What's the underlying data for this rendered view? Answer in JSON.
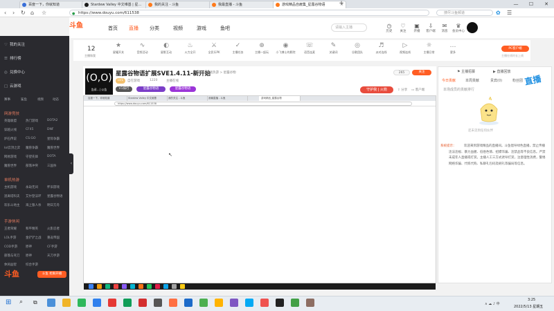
{
  "browser": {
    "tabs": [
      {
        "label": "百度一下，你就知道",
        "active": false
      },
      {
        "label": "Stardew Valley 中文维基 | 星…",
        "active": false
      },
      {
        "label": "我的关注 - 斗鱼",
        "active": false
      },
      {
        "label": "我最直播 - 斗鱼",
        "active": false
      },
      {
        "label": "游戏精品自雇集_星露谷物语",
        "active": true
      }
    ],
    "new_tab": "+",
    "address": "https://www.douyu.com/611538",
    "search_placeholder": "搜尽斗鱼频道"
  },
  "header": {
    "logo": "斗鱼",
    "nav": [
      "首页",
      "直播",
      "分类",
      "视频",
      "游戏",
      "鱼吧"
    ],
    "active_nav": "直播",
    "search_placeholder": "请输入主播",
    "icons": [
      "历史",
      "关注",
      "开播",
      "客户端",
      "消息",
      "会员中心"
    ]
  },
  "categories": {
    "count": "12",
    "count_label": "主播和我",
    "items": [
      "星耀开关",
      "音频活动",
      "星影互动",
      "火力全开",
      "全民乐PK",
      "主播任务",
      "主播一起玩",
      "小飞博士的影院",
      "语音连麦",
      "关键词",
      "谷歌团队",
      "派对连线",
      "视频连线",
      "主播日常",
      "更多"
    ],
    "pc_client": "PC客户端",
    "pc_sub": "主播在线时长上线"
  },
  "sidebar": {
    "items": [
      {
        "icon": "♡",
        "label": "我的关注"
      },
      {
        "icon": "☰",
        "label": "排行榜"
      },
      {
        "icon": "◎",
        "label": "兑换中心"
      },
      {
        "icon": "□",
        "label": "云游戏"
      }
    ],
    "events_row": [
      "赛事",
      "鲨鱼",
      "视频",
      "动态"
    ],
    "sections": [
      {
        "title": "网游竞技",
        "more": "全部 >",
        "games": [
          "英雄联盟",
          "热门游戏",
          "DOTA2",
          "穿越火线",
          "CF45",
          "DNF",
          "炉石传说",
          "CS:GO",
          "星际争霸",
          "lol云顶之弈",
          "魔兽争霸",
          "魔兽世界",
          "网易游戏",
          "守望先锋",
          "DOTA",
          "魔兽世界",
          "部落冲突",
          "三国杀"
        ]
      },
      {
        "title": "单机热游",
        "more": "全部 >",
        "games": [
          "主机游戏",
          "永劫无间",
          "怀旧游戏",
          "逃离塔科夫",
          "艾尔登法环",
          "星露谷物语",
          "欢乐斗地主",
          "海上狼人杀",
          "明日方舟"
        ]
      },
      {
        "title": "手游休闲",
        "more": "全部 >",
        "games": [
          "王者荣耀",
          "和平精英",
          "火影忍者",
          "LOL手游",
          "金铲铲之战",
          "重返帝国",
          "COD手游",
          "原神",
          "CF手游",
          "部落与弯刀",
          "原神",
          "天刀手游",
          "休闲益智",
          "综合手游"
        ]
      }
    ],
    "promo": "斗鱼 抢鲜开播"
  },
  "room": {
    "avatar_text": "告诉…| 公告",
    "title": "星露谷物语扩展SVE1.4.11-新开始",
    "report": "举报",
    "breadcrumb": "游戏热游 > 星露谷物",
    "tags": [
      "LV1",
      "自在游戏",
      "1220",
      "主播在线"
    ],
    "badges": [
      "V1排行",
      "星露谷物语",
      "星露谷物语"
    ],
    "follow_count": "265",
    "follow_label": "关注",
    "gift_label": "守护我 | 火箭",
    "actions": [
      "分享",
      "客户端"
    ]
  },
  "video": {
    "inner_tabs": [
      "百度一下，你就知道",
      "Stardew Valley 中文维基",
      "我的关注 - 斗鱼",
      "我最直播 - 斗鱼",
      "游戏精品_星露谷物"
    ],
    "inner_url": "https://www.douyu.com/611538"
  },
  "right_panel": {
    "top_links": [
      "主播招募",
      "直播回放"
    ],
    "tabs": [
      "今日贡献",
      "本周贡献",
      "贵宾(0)",
      "粉丝团"
    ],
    "note": "本场成员的贡献排行",
    "mascot_caption": "还未见到任何伙伴",
    "badge": "直播",
    "sys_label": "系统提示：",
    "sys_msg": "欢迎来到游戏精品的直播间。斗鱼倡导绿色直播，禁止传播违法违规、暴力血腥、低俗色情、招嫖诈骗、违禁品等不良信息。严禁未成年人直播或打赏。主播人工三方式诱导打赏，注意理性消费，警惕网络诈骗、代练代购、私聊礼包码及刷礼等骗局等信息。"
  },
  "taskbar": {
    "time": "3:25",
    "date": "2022/5/13 星期五",
    "tray": "∧ ☁ ♪ 中"
  },
  "window_controls": [
    "—",
    "☐",
    "✕"
  ]
}
